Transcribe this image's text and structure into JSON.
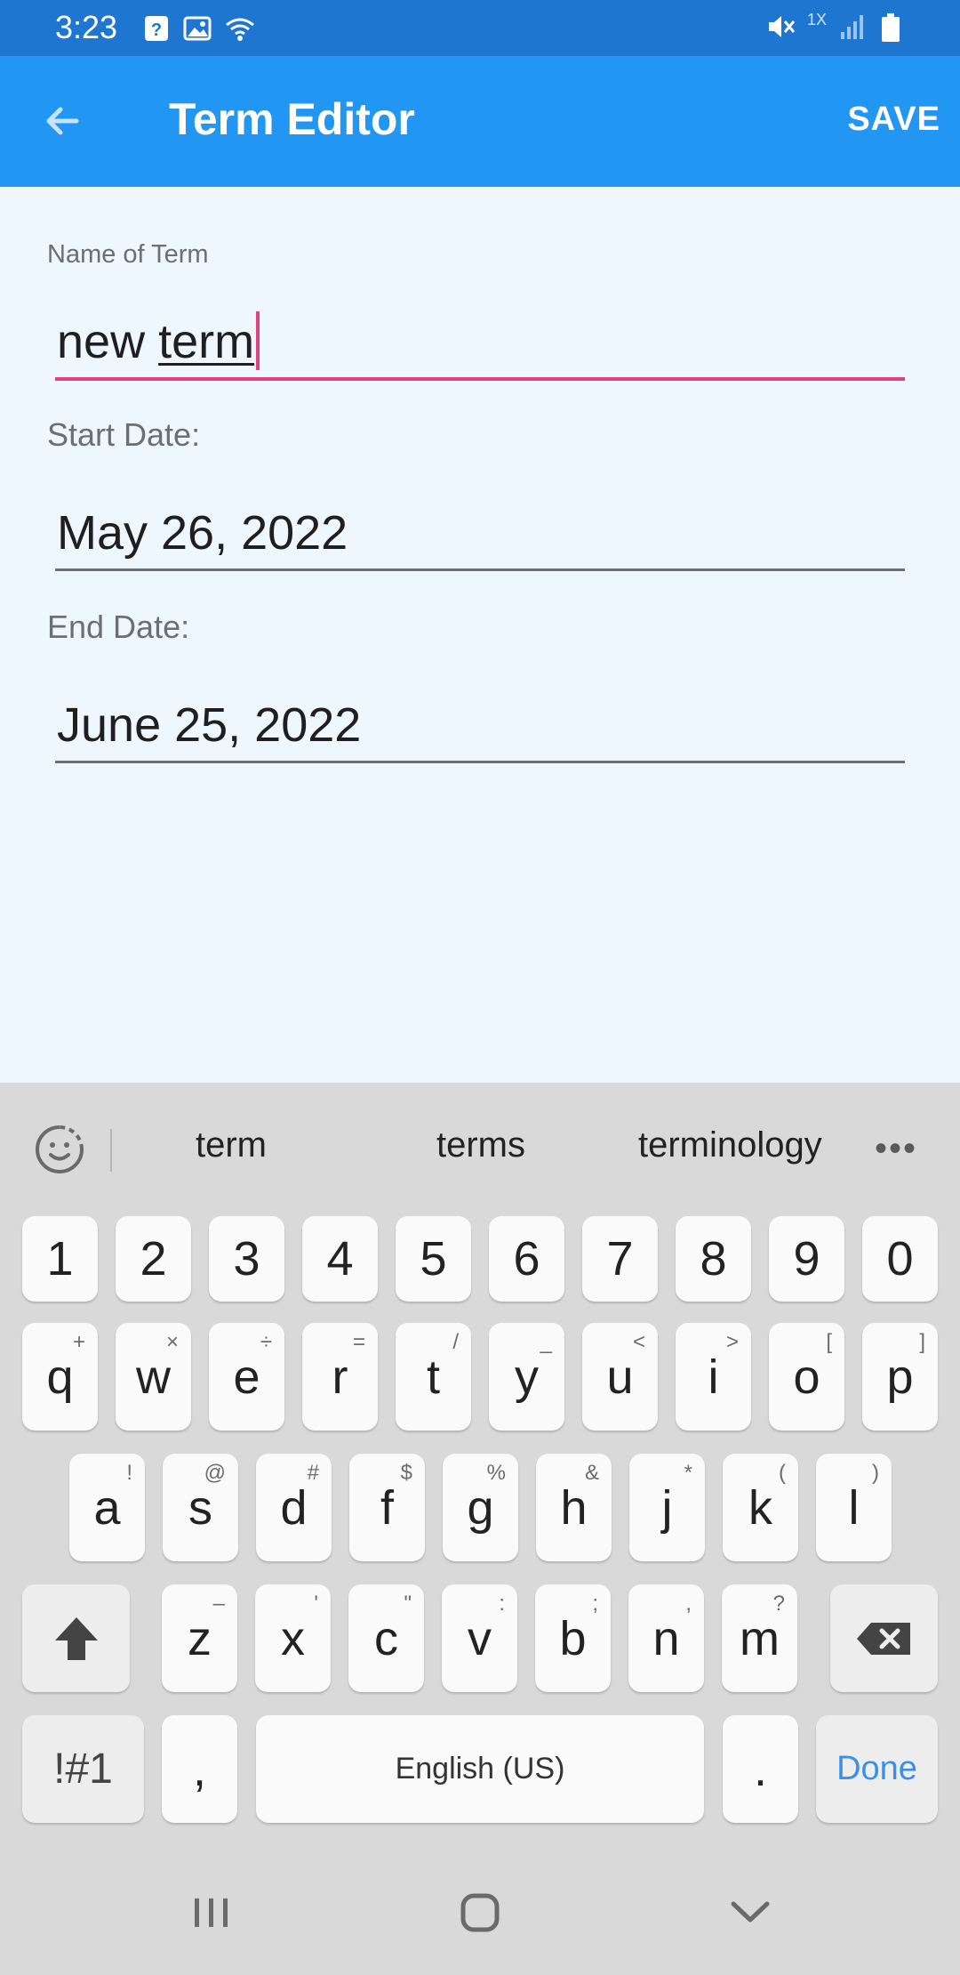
{
  "status_bar": {
    "time": "3:23",
    "left_icons": [
      "question-icon",
      "image-icon",
      "wifi-icon"
    ],
    "right_icons": [
      "mute-icon",
      "signal-icon",
      "battery-icon"
    ],
    "network_label": "1X"
  },
  "app_bar": {
    "title": "Term Editor",
    "save_label": "SAVE",
    "background": "#2196f3",
    "status_background": "#1e76d0"
  },
  "form": {
    "name_label": "Name of Term",
    "name_value_prefix": "new ",
    "name_value_composing": "term",
    "start_label": "Start Date:",
    "start_value": "May 26, 2022",
    "end_label": "End Date:",
    "end_value": "June 25, 2022",
    "focus_color": "#e0407f"
  },
  "keyboard": {
    "suggestions": [
      "term",
      "terms",
      "terminology"
    ],
    "more_label": "•••",
    "number_row": [
      "1",
      "2",
      "3",
      "4",
      "5",
      "6",
      "7",
      "8",
      "9",
      "0"
    ],
    "row1": [
      {
        "key": "q",
        "alt": "+"
      },
      {
        "key": "w",
        "alt": "×"
      },
      {
        "key": "e",
        "alt": "÷"
      },
      {
        "key": "r",
        "alt": "="
      },
      {
        "key": "t",
        "alt": "/"
      },
      {
        "key": "y",
        "alt": "_"
      },
      {
        "key": "u",
        "alt": "<"
      },
      {
        "key": "i",
        "alt": ">"
      },
      {
        "key": "o",
        "alt": "["
      },
      {
        "key": "p",
        "alt": "]"
      }
    ],
    "row2": [
      {
        "key": "a",
        "alt": "!"
      },
      {
        "key": "s",
        "alt": "@"
      },
      {
        "key": "d",
        "alt": "#"
      },
      {
        "key": "f",
        "alt": "$"
      },
      {
        "key": "g",
        "alt": "%"
      },
      {
        "key": "h",
        "alt": "&"
      },
      {
        "key": "j",
        "alt": "*"
      },
      {
        "key": "k",
        "alt": "("
      },
      {
        "key": "l",
        "alt": ")"
      }
    ],
    "row3": [
      {
        "key": "z",
        "alt": "–"
      },
      {
        "key": "x",
        "alt": "'"
      },
      {
        "key": "c",
        "alt": "\""
      },
      {
        "key": "v",
        "alt": ":"
      },
      {
        "key": "b",
        "alt": ";"
      },
      {
        "key": "n",
        "alt": ","
      },
      {
        "key": "m",
        "alt": "?"
      }
    ],
    "symbols_label": "!#1",
    "comma_label": ",",
    "space_label": "English (US)",
    "period_label": ".",
    "done_label": "Done"
  },
  "nav_bar": {
    "buttons": [
      "recents-icon",
      "home-icon",
      "back-chevron-icon"
    ]
  }
}
